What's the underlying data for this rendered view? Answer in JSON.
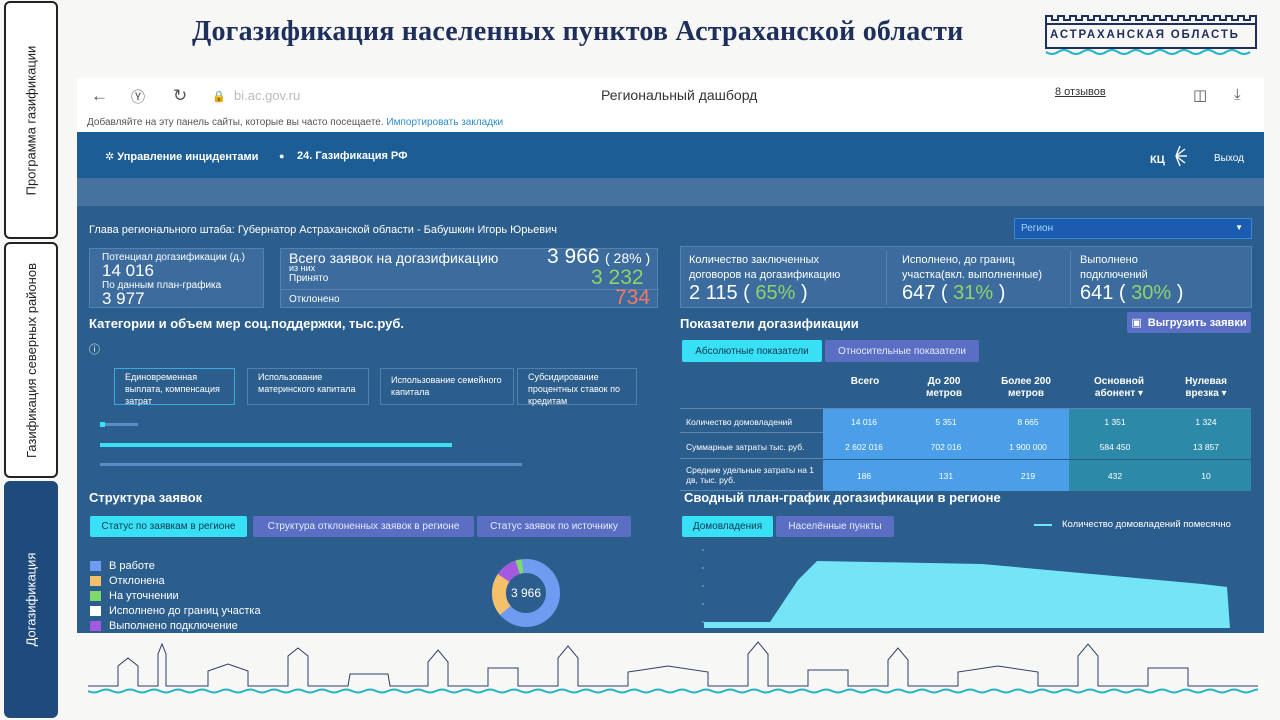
{
  "side_tabs": [
    {
      "label": "Программа газификации"
    },
    {
      "label": "Газификация северных районов"
    },
    {
      "label": "Догазификация"
    }
  ],
  "slide_title": "Догазификация населенных пунктов Астраханской области",
  "logo_text": "АСТРАХАНСКАЯ ОБЛАСТЬ",
  "browser": {
    "url": "bi.ac.gov.ru",
    "page_title": "Региональный дашборд",
    "reviews": "8 отзывов",
    "bookmarks_text": "Добавляйте на эту панель сайты, которые вы часто посещаете.",
    "bookmarks_link": "Импортировать закладки"
  },
  "app": {
    "nav_item_1": "Управление инцидентами",
    "nav_item_2": "24. Газификация РФ",
    "logo": "КЦ",
    "logout": "Выход"
  },
  "dashboard": {
    "head_label": "Глава регионального штаба: Губернатор Астраханской области - Бабушкин Игорь Юрьевич",
    "region_select": "Регион",
    "potential_label": "Потенциал догазификации (д.)",
    "potential_value": "14 016",
    "plan_label": "По данным план-графика",
    "plan_value": "3 977",
    "total_label": "Всего заявок на догазификацию",
    "of_them": "из них",
    "total_value": "3 966",
    "total_pct": "( 28% )",
    "accepted_label": "Принято",
    "accepted_value": "3 232",
    "rejected_label": "Отклонено",
    "rejected_value": "734",
    "contracts_label": "Количество заключенных договоров на догазификацию",
    "contracts_value": "2 115",
    "contracts_pct": "65%",
    "done_border_label": "Исполнено, до границ участка(вкл. выполненные)",
    "done_border_value": "647",
    "done_border_pct": "31%",
    "connections_label": "Выполнено подключений",
    "connections_value": "641",
    "connections_pct": "30%",
    "categories_title": "Категории и объем мер соц.поддержки, тыс.руб.",
    "categories": [
      "Единовременная выплата, компенсация затрат",
      "Использование материнского капитала",
      "Использование семейного капитала",
      "Субсидирование процентных ставок по кредитам"
    ],
    "indicators_title": "Показатели догазификации",
    "export_button": "Выгрузить заявки",
    "tab_absolute": "Абсолютные показатели",
    "tab_relative": "Относительные показатели",
    "table": {
      "columns": [
        "Всего",
        "До 200 метров",
        "Более 200 метров",
        "Основной абонент",
        "Нулевая врезка"
      ],
      "rows": [
        {
          "label": "Количество домовладений",
          "values": [
            "14 016",
            "5 351",
            "8 665",
            "1 351",
            "1 324"
          ]
        },
        {
          "label": "Суммарные затраты тыс. руб.",
          "values": [
            "2 602 016",
            "702 016",
            "1 900 000",
            "584 450",
            "13 857"
          ]
        },
        {
          "label": "Средние удельные затраты на 1 дв, тыс. руб.",
          "values": [
            "186",
            "131",
            "219",
            "432",
            "10"
          ]
        }
      ]
    },
    "structure_title": "Структура заявок",
    "structure_tabs": [
      "Статус по заявкам в регионе",
      "Структура отклоненных заявок в регионе",
      "Статус заявок по источнику"
    ],
    "legend": [
      {
        "label": "В работе",
        "color": "#6f9bf0"
      },
      {
        "label": "Отклонена",
        "color": "#f4c06a"
      },
      {
        "label": "На уточнении",
        "color": "#7fd86a"
      },
      {
        "label": "Исполнено до границ участка",
        "color": "#ffffff"
      },
      {
        "label": "Выполнено подключение",
        "color": "#a35ae0"
      }
    ],
    "donut_center": "3 966",
    "schedule_title": "Сводный план-график догазификации в регионе",
    "schedule_tabs": [
      "Домовладения",
      "Населённые пункты"
    ],
    "schedule_legend": "Количество домовладений помесячно"
  }
}
